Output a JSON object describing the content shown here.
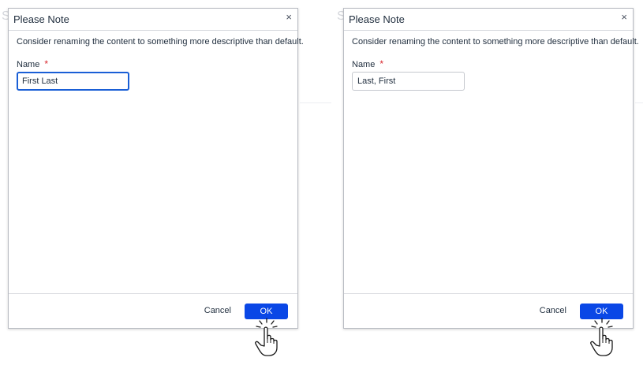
{
  "background": {
    "ghost_left": "S",
    "ghost_right": "S"
  },
  "dialogs": [
    {
      "title": "Please Note",
      "close_glyph": "×",
      "message": "Consider renaming the content to something more descriptive than default.",
      "field_label": "Name",
      "required_mark": "*",
      "input_value": "First Last",
      "input_focused": true,
      "cancel_label": "Cancel",
      "ok_label": "OK",
      "cursor_icon": "hand-pointer-icon"
    },
    {
      "title": "Please Note",
      "close_glyph": "×",
      "message": "Consider renaming the content to something more descriptive than default.",
      "field_label": "Name",
      "required_mark": "*",
      "input_value": "Last, First",
      "input_focused": false,
      "cancel_label": "Cancel",
      "ok_label": "OK",
      "cursor_icon": "hand-pointer-icon"
    }
  ],
  "colors": {
    "accent": "#0a47e6",
    "focus_border": "#1a5fd6",
    "required": "#d9262c",
    "text": "#1f2d3d"
  }
}
